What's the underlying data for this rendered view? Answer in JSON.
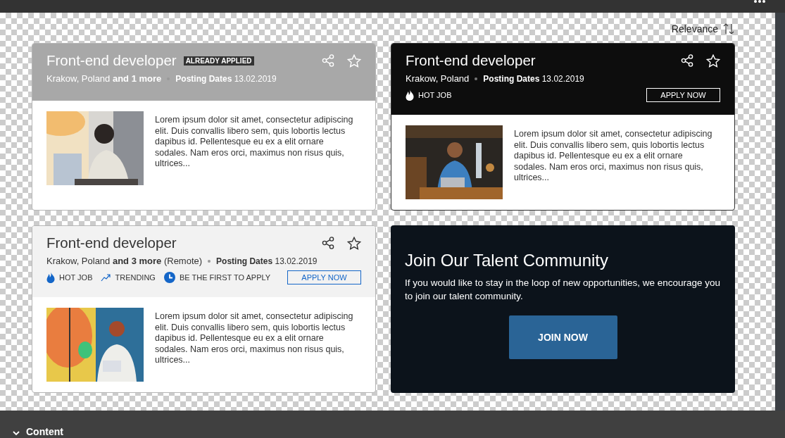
{
  "sort": {
    "label": "Relevance"
  },
  "cards": [
    {
      "kind": "job",
      "title": "Front-end developer",
      "applied": true,
      "highlighted": false,
      "applied_label": "ALREADY APPLIED",
      "location": "Krakow, Poland **and 1 more**",
      "posting": "**Posting Dates** 13.02.2019",
      "description": "Lorem ipsum dolor sit amet, consectetur adipiscing elit. Duis convallis libero sem, quis lobortis lectus dapibus id. Pellentesque eu ex a elit ornare sodales. Nam eros orci, maximus non risus quis, ultrices...",
      "image": {
        "kind": "picture"
      }
    },
    {
      "kind": "job",
      "title": "Front-end developer",
      "applied": false,
      "highlighted": true,
      "location": "Krakow, Poland",
      "posting": "**Posting Dates** 13.02.2019",
      "tags": [
        {
          "kind": "hot",
          "label": "HOT JOB"
        }
      ],
      "apply": "APPLY NOW",
      "description": "Lorem ipsum dolor sit amet, consectetur adipiscing elit. Duis convallis libero sem, quis lobortis lectus dapibus id. Pellentesque eu ex a elit ornare sodales. Nam eros orci, maximus non risus quis, ultrices...",
      "image": {
        "kind": "picture"
      }
    },
    {
      "kind": "job",
      "title": "Front-end developer",
      "applied": false,
      "highlighted": false,
      "location": "Krakow, Poland **and 3 more** (Remote)",
      "posting": "**Posting Dates** 13.02.2019",
      "tags": [
        {
          "kind": "hot",
          "label": "HOT JOB"
        },
        {
          "kind": "trending",
          "label": "TRENDING"
        },
        {
          "kind": "first",
          "label": "BE THE FIRST TO APPLY"
        }
      ],
      "apply": "APPLY NOW",
      "description": "Lorem ipsum dolor sit amet, consectetur adipiscing elit. Duis convallis libero sem, quis lobortis lectus dapibus id. Pellentesque eu ex a elit ornare sodales. Nam eros orci, maximus non risus quis, ultrices...",
      "image": {
        "kind": "picture"
      }
    },
    {
      "kind": "promo",
      "title": "Join Our Talent Community",
      "text": "If you would like to stay in the loop of new opportunities, we encourage you to join our talent community.",
      "button": "JOIN NOW"
    }
  ],
  "bottom_panel": {
    "title": "Content",
    "expanded": true
  }
}
